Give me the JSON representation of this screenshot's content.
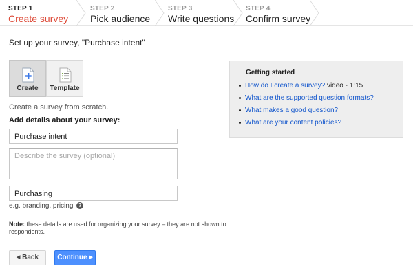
{
  "steps": [
    {
      "number": "STEP 1",
      "name": "Create survey"
    },
    {
      "number": "STEP 2",
      "name": "Pick audience"
    },
    {
      "number": "STEP 3",
      "name": "Write questions"
    },
    {
      "number": "STEP 4",
      "name": "Confirm survey"
    }
  ],
  "page_title": "Set up your survey, \"Purchase intent\"",
  "tiles": {
    "create_label": "Create",
    "template_label": "Template",
    "create_icon": "plus-document-icon",
    "template_icon": "document-lines-icon"
  },
  "create_description": "Create a survey from scratch.",
  "add_details_label": "Add details about your survey:",
  "form": {
    "title_value": "Purchase intent",
    "description_placeholder": "Describe the survey (optional)",
    "category_value": "Purchasing"
  },
  "hint": "e.g. branding, pricing",
  "help_icon_glyph": "?",
  "note": {
    "label": "Note:",
    "text": "these details are used for organizing your survey – they are not shown to respondents."
  },
  "buttons": {
    "back_label": "Back",
    "continue_label": "Continue"
  },
  "getting_started": {
    "title": "Getting started",
    "items": [
      {
        "link": "How do I create a survey?",
        "suffix": " video - 1:15"
      },
      {
        "link": "What are the supported question formats?",
        "suffix": ""
      },
      {
        "link": "What makes a good question?",
        "suffix": ""
      },
      {
        "link": "What are your content policies?",
        "suffix": ""
      }
    ]
  },
  "colors": {
    "active_step": "#dd4b39",
    "primary_button": "#4d90fe",
    "link": "#1155cc"
  }
}
